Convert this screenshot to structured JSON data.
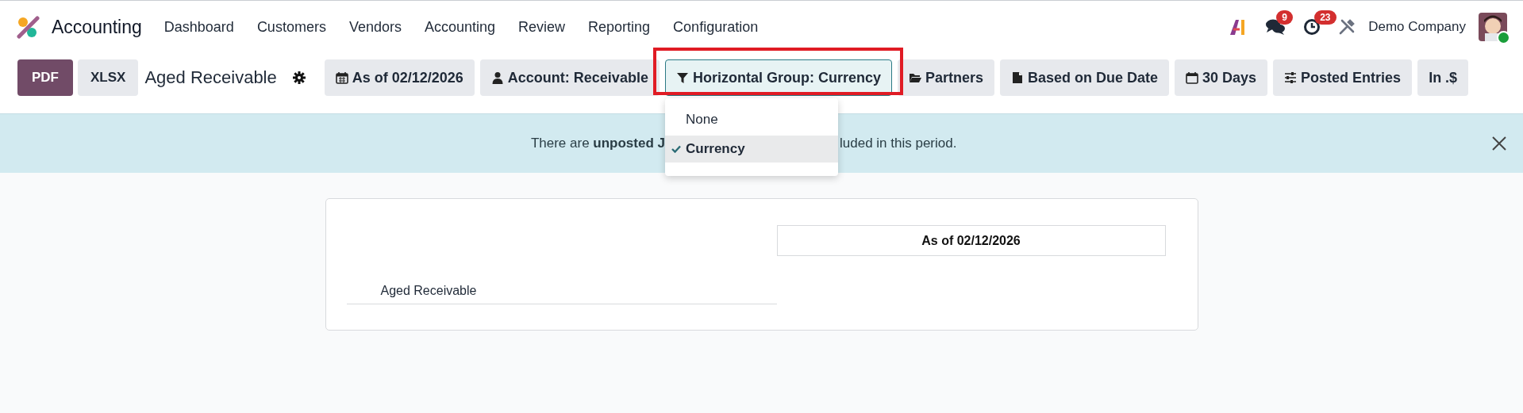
{
  "app": {
    "name": "Accounting"
  },
  "menu": [
    {
      "label": "Dashboard"
    },
    {
      "label": "Customers"
    },
    {
      "label": "Vendors"
    },
    {
      "label": "Accounting"
    },
    {
      "label": "Review"
    },
    {
      "label": "Reporting"
    },
    {
      "label": "Configuration"
    }
  ],
  "systray": {
    "messages_badge": "9",
    "activities_badge": "23",
    "company": "Demo Company"
  },
  "toolbar": {
    "export_buttons": [
      {
        "label": "PDF",
        "kind": "primary"
      },
      {
        "label": "XLSX",
        "kind": "secondary"
      }
    ],
    "report_title": "Aged Receivable",
    "filters": [
      {
        "label": "As of 02/12/2026",
        "kind": "date",
        "selected": false
      },
      {
        "label": "Account: Receivable",
        "kind": "account",
        "selected": false
      },
      {
        "label": "Horizontal Group: Currency",
        "kind": "grouping",
        "selected": true
      },
      {
        "label": "Partners",
        "kind": "partners",
        "selected": false
      },
      {
        "label": "Based on Due Date",
        "kind": "basis",
        "selected": false
      },
      {
        "label": "30 Days",
        "kind": "period",
        "selected": false
      },
      {
        "label": "Posted Entries",
        "kind": "entries",
        "selected": false
      },
      {
        "label": "In .$",
        "kind": "rounding",
        "selected": false
      }
    ]
  },
  "banner": {
    "text_before": "There are **unposted J**",
    "text_after": "luded in this period."
  },
  "dropdown": {
    "options": [
      {
        "label": "None",
        "selected": false
      },
      {
        "label": "Currency",
        "selected": true
      }
    ]
  },
  "report": {
    "column_header": "As of 02/12/2026",
    "rows": [
      {
        "label": "Aged Receivable"
      }
    ]
  }
}
